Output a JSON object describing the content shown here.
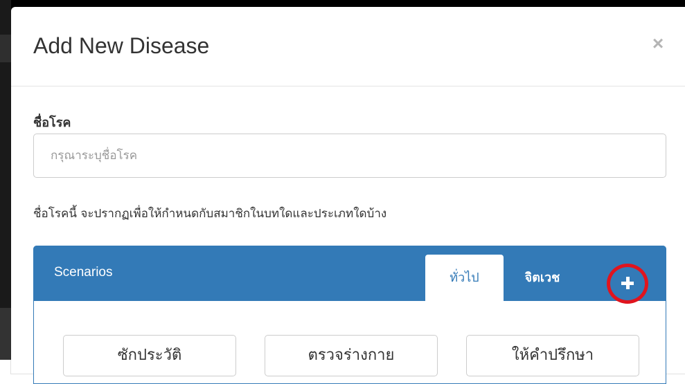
{
  "modal": {
    "title": "Add New Disease",
    "close_label": "×"
  },
  "form": {
    "name_label": "ชื่อโรค",
    "name_placeholder": "กรุณาระบุชื่อโรค",
    "name_value": "",
    "help_text": "ชื่อโรคนี้ จะปรากฏเพื่อให้กำหนดกับสมาชิกในบทใดและประเภทใดบ้าง"
  },
  "scenarios_panel": {
    "title": "Scenarios",
    "tabs": [
      {
        "label": "ทั่วไป",
        "active": true
      },
      {
        "label": "จิตเวช",
        "active": false
      }
    ],
    "add_tab_icon": "plus-icon",
    "add_tab_highlight_color": "#e0141e",
    "buttons": [
      {
        "label": "ซักประวัติ"
      },
      {
        "label": "ตรวจร่างกาย"
      },
      {
        "label": "ให้คำปรึกษา"
      }
    ]
  },
  "colors": {
    "primary": "#337ab7",
    "highlight": "#e0141e"
  }
}
